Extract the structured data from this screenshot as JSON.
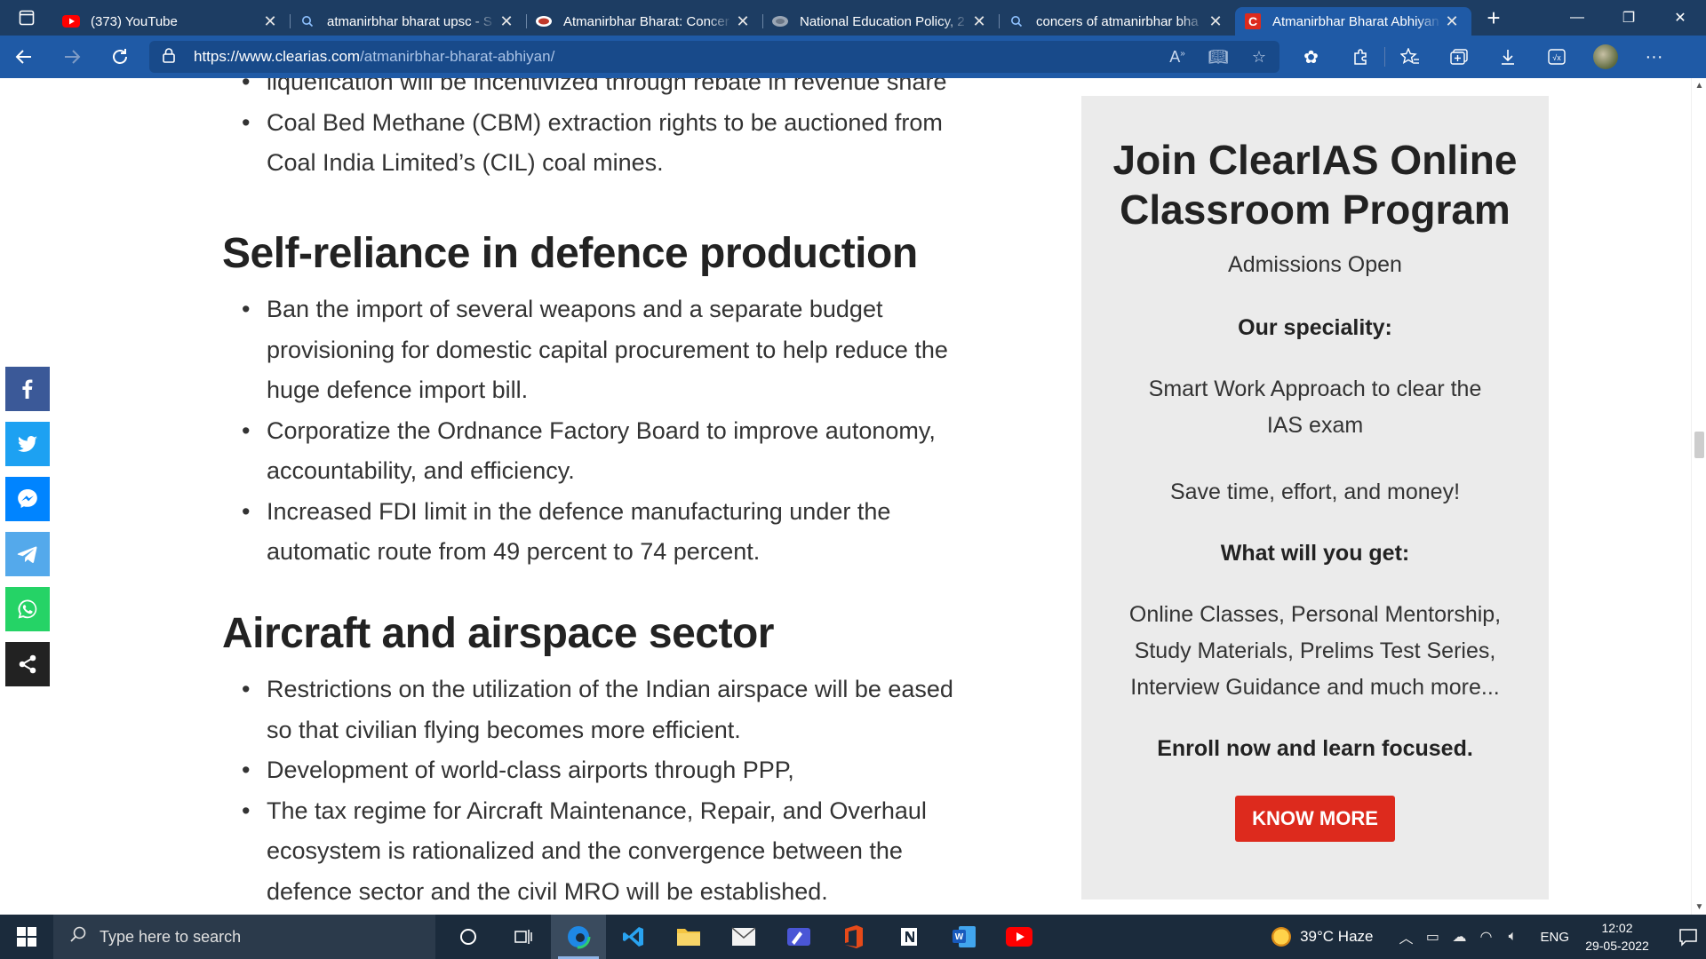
{
  "browser": {
    "tabs": [
      {
        "title": "(373) YouTube",
        "favicon": "youtube-icon",
        "active": false
      },
      {
        "title": "atmanirbhar bharat upsc - S",
        "favicon": "search-icon",
        "active": false
      },
      {
        "title": "Atmanirbhar Bharat: Concer",
        "favicon": "site-icon",
        "active": false
      },
      {
        "title": "National Education Policy, 2",
        "favicon": "site-icon",
        "active": false
      },
      {
        "title": "concers of atmanirbhar bha",
        "favicon": "search-icon",
        "active": false
      },
      {
        "title": "Atmanirbhar Bharat Abhiyan",
        "favicon": "clearias-icon",
        "active": true
      }
    ],
    "url_host": "https://www.clearias.com",
    "url_path": "/atmanirbhar-bharat-abhiyan/",
    "accent": "#1f5aa6",
    "tabbar_color": "#1d3d63"
  },
  "article": {
    "section1_items": [
      "liquefication will be incentivized through rebate in revenue share",
      "Coal Bed Methane (CBM) extraction rights to be auctioned from Coal India Limited’s (CIL) coal mines."
    ],
    "heading_defence": "Self-reliance in defence production",
    "defence_items": [
      "Ban the import of several weapons and a separate budget provisioning for domestic capital procurement to help reduce the huge defence import bill.",
      "Corporatize the Ordnance Factory Board to improve autonomy, accountability, and efficiency.",
      "Increased FDI limit in the defence manufacturing under the automatic route from 49 percent to 74 percent."
    ],
    "heading_aircraft": "Aircraft and airspace sector",
    "aircraft_items": [
      "Restrictions on the utilization of the Indian airspace will be eased so that civilian flying becomes more efficient.",
      "Development of world-class airports through PPP,",
      "The tax regime for Aircraft Maintenance, Repair, and Overhaul ecosystem is rationalized and the convergence between the defence sector and the civil MRO will be established."
    ]
  },
  "sidebar": {
    "title": "Join ClearIAS Online Classroom Program",
    "subtitle": "Admissions Open",
    "speciality_label": "Our speciality:",
    "speciality_text": "Smart Work Approach to clear the IAS exam",
    "save_text": "Save time, effort, and money!",
    "get_label": "What will you get:",
    "get_text": "Online Classes, Personal Mentorship, Study Materials, Prelims Test Series, Interview Guidance and much more...",
    "enroll_text": "Enroll now and learn focused.",
    "button_label": "KNOW MORE",
    "button_color": "#dd2a1d"
  },
  "share": {
    "buttons": [
      {
        "name": "facebook-share",
        "icon": "facebook-icon",
        "color": "#3b5998"
      },
      {
        "name": "twitter-share",
        "icon": "twitter-icon",
        "color": "#1da1f2"
      },
      {
        "name": "messenger-share",
        "icon": "messenger-icon",
        "color": "#0084ff"
      },
      {
        "name": "telegram-share",
        "icon": "telegram-icon",
        "color": "#54a9eb"
      },
      {
        "name": "whatsapp-share",
        "icon": "whatsapp-icon",
        "color": "#25d366"
      },
      {
        "name": "more-share",
        "icon": "share-icon",
        "color": "#222222"
      }
    ]
  },
  "taskbar": {
    "search_placeholder": "Type here to search",
    "weather": "39°C  Haze",
    "lang": "ENG",
    "time": "12:02",
    "date": "29-05-2022"
  }
}
